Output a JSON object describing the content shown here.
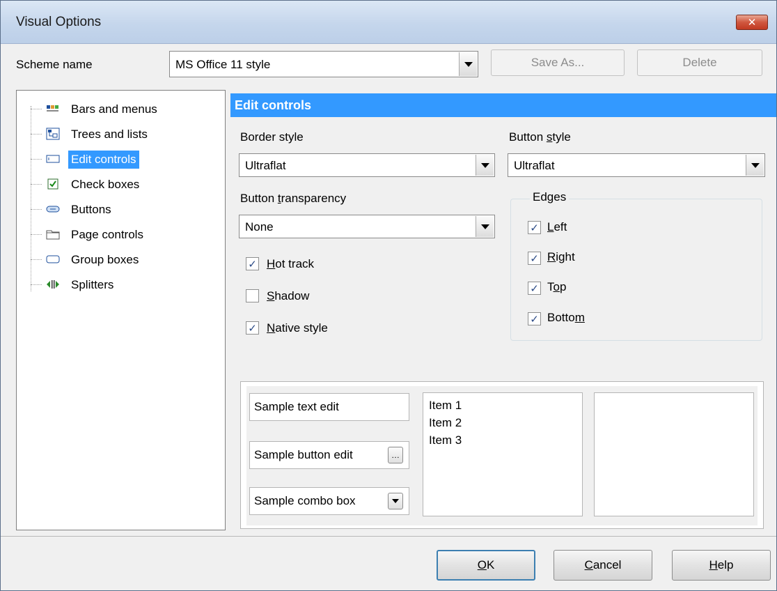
{
  "window": {
    "title": "Visual Options",
    "close_glyph": "✕"
  },
  "scheme": {
    "label": "Scheme name",
    "value": "MS Office 11 style",
    "save_as_label": "Save As...",
    "delete_label": "Delete"
  },
  "tree": {
    "items": [
      {
        "label": "Bars and menus",
        "icon": "bars-menus-icon"
      },
      {
        "label": "Trees and lists",
        "icon": "trees-lists-icon"
      },
      {
        "label": "Edit controls",
        "icon": "edit-control-icon",
        "selected": true
      },
      {
        "label": "Check boxes",
        "icon": "checkbox-icon"
      },
      {
        "label": "Buttons",
        "icon": "button-icon"
      },
      {
        "label": "Page controls",
        "icon": "folder-tab-icon"
      },
      {
        "label": "Group boxes",
        "icon": "group-box-icon"
      },
      {
        "label": "Splitters",
        "icon": "splitter-icon"
      }
    ]
  },
  "panel": {
    "header": "Edit controls",
    "border_style": {
      "label": "Border style",
      "value": "Ultraflat"
    },
    "button_style": {
      "label_pre": "Button ",
      "label_u": "s",
      "label_post": "tyle",
      "value": "Ultraflat"
    },
    "button_transparency": {
      "label_pre": "Button ",
      "label_u": "t",
      "label_post": "ransparency",
      "value": "None"
    },
    "options": {
      "hot_track": {
        "u": "H",
        "rest": "ot track",
        "checked": true
      },
      "shadow": {
        "u": "S",
        "rest": "hadow",
        "checked": false
      },
      "native_style": {
        "u": "N",
        "rest": "ative style",
        "checked": true
      }
    },
    "edges": {
      "title": "Edges",
      "left": {
        "u": "L",
        "rest": "eft",
        "checked": true
      },
      "right": {
        "u": "R",
        "rest": "ight",
        "checked": true
      },
      "top": {
        "pre": "T",
        "u": "o",
        "rest": "p",
        "checked": true
      },
      "bottom": {
        "pre": "Botto",
        "u": "m",
        "rest": "",
        "checked": true
      }
    }
  },
  "samples": {
    "text_edit": "Sample text edit",
    "button_edit": "Sample button edit",
    "button_edit_glyph": "…",
    "combo_box": "Sample combo box",
    "list_items": [
      "Item 1",
      "Item 2",
      "Item 3"
    ]
  },
  "footer": {
    "ok": {
      "u": "O",
      "rest": "K"
    },
    "cancel": {
      "u": "C",
      "rest": "ancel"
    },
    "help": {
      "u": "H",
      "rest": "elp"
    }
  },
  "colors": {
    "selection": "#3399ff",
    "check": "#2b4a86"
  }
}
